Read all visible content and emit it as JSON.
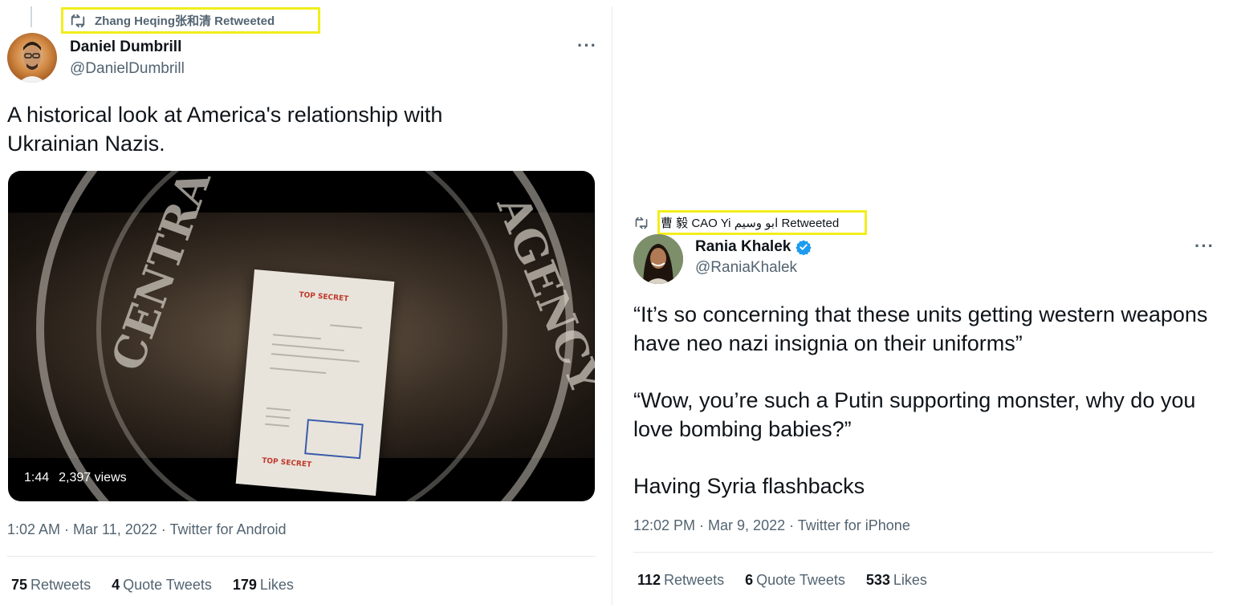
{
  "left_tweet": {
    "retweeted_by": "Zhang Heqing张和清 Retweeted",
    "author_name": "Daniel Dumbrill",
    "author_handle": "@DanielDumbrill",
    "more_label": "···",
    "text": "A historical look at America's relationship with Ukrainian Nazis.",
    "video": {
      "duration": "1:44",
      "views": "2,397 views"
    },
    "timestamp": "1:02 AM · Mar 11, 2022 · Twitter for Android",
    "stats": [
      {
        "count": "75",
        "label": "Retweets"
      },
      {
        "count": "4",
        "label": "Quote Tweets"
      },
      {
        "count": "179",
        "label": "Likes"
      }
    ]
  },
  "right_tweet": {
    "retweeted_by": "曹 毅 CAO Yi ابو وسيم Retweeted",
    "author_name": "Rania Khalek",
    "author_handle": "@RaniaKhalek",
    "more_label": "···",
    "paragraphs": [
      "“It’s so concerning that these units getting western weapons have neo nazi insignia on their uniforms”",
      "“Wow, you’re such a Putin supporting monster, why do you love bombing  babies?”",
      "Having Syria flashbacks"
    ],
    "timestamp": "12:02 PM · Mar 9, 2022 · Twitter for iPhone",
    "stats": [
      {
        "count": "112",
        "label": "Retweets"
      },
      {
        "count": "6",
        "label": "Quote Tweets"
      },
      {
        "count": "533",
        "label": "Likes"
      }
    ]
  },
  "colors": {
    "highlight": "#f2ee1c",
    "verified": "#1d9bf0",
    "secondary_text": "#536471"
  }
}
